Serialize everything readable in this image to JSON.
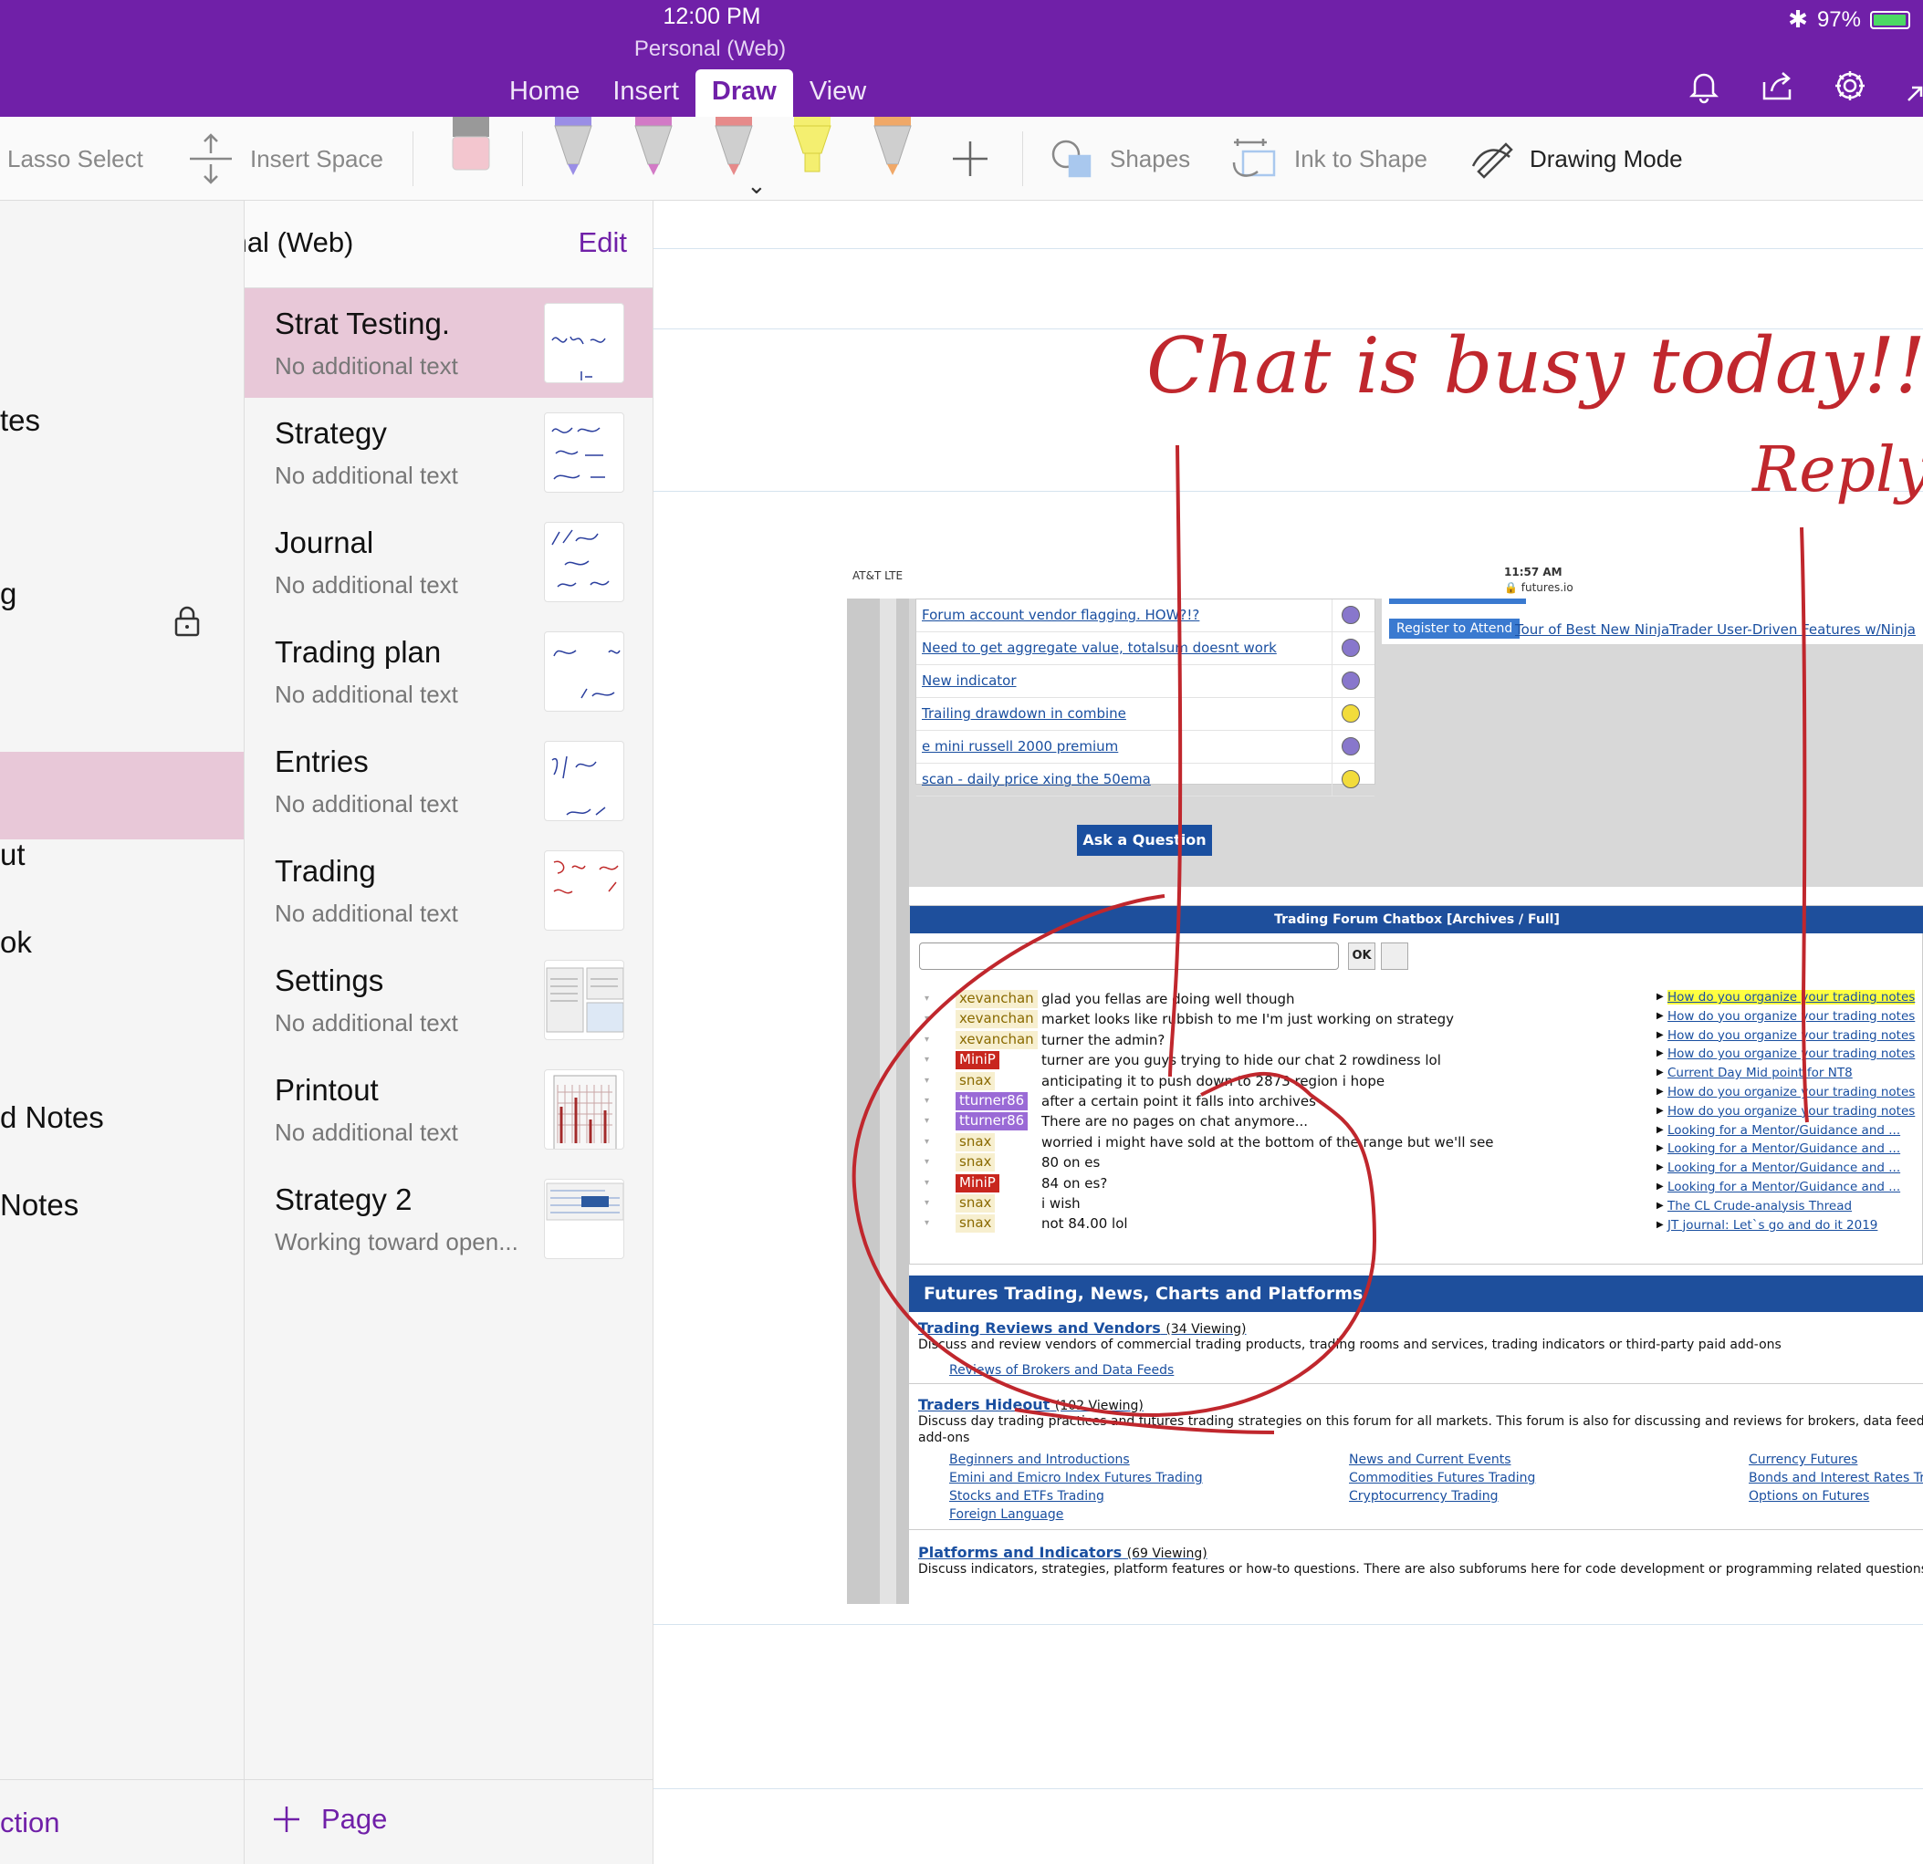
{
  "status": {
    "time": "12:00 PM",
    "battery": "97%",
    "battery_level": 0.97
  },
  "notebook_title": "Personal (Web)",
  "tabs": [
    {
      "label": "Home"
    },
    {
      "label": "Insert"
    },
    {
      "label": "Draw"
    },
    {
      "label": "View"
    }
  ],
  "active_tab": "Draw",
  "top_icons": [
    "bell-icon",
    "share-icon",
    "gear-icon",
    "collapse-icon"
  ],
  "toolbar": {
    "lasso": "Lasso Select",
    "insert_space": "Insert Space",
    "shapes": "Shapes",
    "ink_to_shape": "Ink to Shape",
    "drawing_mode": "Drawing Mode",
    "pens": [
      {
        "color": "#9a8ee6"
      },
      {
        "color": "#d27ac6"
      },
      {
        "color": "#e68a8a"
      },
      {
        "color": "#f4ef70"
      },
      {
        "color": "#f0a868"
      }
    ]
  },
  "panel": {
    "title": "Personal (Web)",
    "edit": "Edit"
  },
  "sections": [
    {
      "label": "tes"
    },
    {
      "label": "g"
    },
    {
      "label": "ut"
    },
    {
      "label": "ok"
    },
    {
      "label": "d Notes"
    },
    {
      "label": "Notes"
    }
  ],
  "pages": [
    {
      "title": "Strat Testing.",
      "subtitle": "No additional text",
      "selected": true
    },
    {
      "title": "Strategy",
      "subtitle": "No additional text"
    },
    {
      "title": "Journal",
      "subtitle": "No additional text"
    },
    {
      "title": "Trading plan",
      "subtitle": "No additional text"
    },
    {
      "title": "Entries",
      "subtitle": "No additional text"
    },
    {
      "title": "Trading",
      "subtitle": "No additional text"
    },
    {
      "title": "Settings",
      "subtitle": "No additional text"
    },
    {
      "title": "Printout",
      "subtitle": "No additional text"
    },
    {
      "title": "Strategy 2",
      "subtitle": "Working toward open..."
    }
  ],
  "bottom": {
    "add_section": "ction",
    "add_page": "Page"
  },
  "handwriting": {
    "line1": "Chat is busy today!!",
    "line2": "Reply"
  },
  "screenshot": {
    "carrier": "AT&T  LTE",
    "time": "11:57 AM",
    "url": "futures.io",
    "topics": [
      {
        "title": "Forum account vendor flagging. HOW?!?",
        "emoji": "sad"
      },
      {
        "title": "Need to get aggregate value, totalsum doesnt work",
        "emoji": "sad"
      },
      {
        "title": "New indicator",
        "emoji": "sad"
      },
      {
        "title": "Trailing drawdown in combine",
        "emoji": "happy"
      },
      {
        "title": "e mini russell 2000 premium",
        "emoji": "sad"
      },
      {
        "title": "scan - daily price xing the 50ema",
        "emoji": "happy"
      }
    ],
    "ask_button": "Ask a Question",
    "register_button": "Register to Attend",
    "register_link": "Tour of Best New NinjaTrader User-Driven Features w/Ninja",
    "chatbox_title": "Trading Forum Chatbox  [Archives / Full]",
    "ok_label": "OK",
    "chat": [
      {
        "user": "xevanchan",
        "msg": "glad you fellas are doing well though",
        "kind": "a"
      },
      {
        "user": "xevanchan",
        "msg": "market looks like rubbish to me I'm just working on strategy",
        "kind": "a"
      },
      {
        "user": "xevanchan",
        "msg": "turner the admin?",
        "kind": "a"
      },
      {
        "user": "MiniP",
        "msg": "turner are you guys trying to hide our chat 2 rowdiness lol",
        "kind": "r"
      },
      {
        "user": "snax",
        "msg": "anticipating it to push down to 2873 region i hope",
        "kind": "a"
      },
      {
        "user": "tturner86",
        "msg": "after a certain point it falls into archives",
        "kind": "p"
      },
      {
        "user": "tturner86",
        "msg": "There are no pages on chat anymore...",
        "kind": "p"
      },
      {
        "user": "snax",
        "msg": "worried i might have sold at the bottom of the range but we'll see",
        "kind": "a"
      },
      {
        "user": "snax",
        "msg": "80 on es",
        "kind": "a"
      },
      {
        "user": "MiniP",
        "msg": "84 on es?",
        "kind": "r"
      },
      {
        "user": "snax",
        "msg": "i wish",
        "kind": "a"
      },
      {
        "user": "snax",
        "msg": "not 84.00 lol",
        "kind": "a"
      }
    ],
    "side_links": [
      {
        "text": "How do you organize your trading notes",
        "hl": true
      },
      {
        "text": "How do you organize your trading notes"
      },
      {
        "text": "How do you organize your trading notes"
      },
      {
        "text": "How do you organize your trading notes"
      },
      {
        "text": "Current Day Mid point for NT8"
      },
      {
        "text": "How do you organize your trading notes"
      },
      {
        "text": "How do you organize your trading notes"
      },
      {
        "text": "Looking for a Mentor/Guidance and ..."
      },
      {
        "text": "Looking for a Mentor/Guidance and ..."
      },
      {
        "text": "Looking for a Mentor/Guidance and ..."
      },
      {
        "text": "Looking for a Mentor/Guidance and ..."
      },
      {
        "text": "The CL Crude-analysis Thread"
      },
      {
        "text": "JT journal: Let`s go and do it 2019"
      }
    ],
    "forum_header": "Futures Trading, News, Charts and Platforms",
    "forums": [
      {
        "title": "Trading Reviews and Vendors",
        "viewing": "(34 Viewing)",
        "desc": "Discuss and review vendors of commercial trading products, trading rooms and services, trading indicators or third-party paid add-ons",
        "subs": [
          "Reviews of Brokers and Data Feeds"
        ]
      },
      {
        "title": "Traders Hideout",
        "viewing": "(102 Viewing)",
        "desc": "Discuss day trading practices and futures trading strategies on this forum for all markets. This forum is also for discussing and reviews for brokers, data feeds, an",
        "desc2": "add-ons",
        "subs": [
          "Beginners and Introductions",
          "Emini and Emicro Index Futures Trading",
          "Stocks and ETFs Trading",
          "Foreign Language",
          "News and Current Events",
          "Commodities Futures Trading",
          "Cryptocurrency Trading",
          "Currency Futures",
          "Bonds and Interest Rates Tr",
          "Options on Futures"
        ]
      },
      {
        "title": "Platforms and Indicators",
        "viewing": "(69 Viewing)",
        "desc": "Discuss indicators, strategies, platform features or how-to questions. There are also subforums here for code development or programming related questions for"
      }
    ]
  }
}
